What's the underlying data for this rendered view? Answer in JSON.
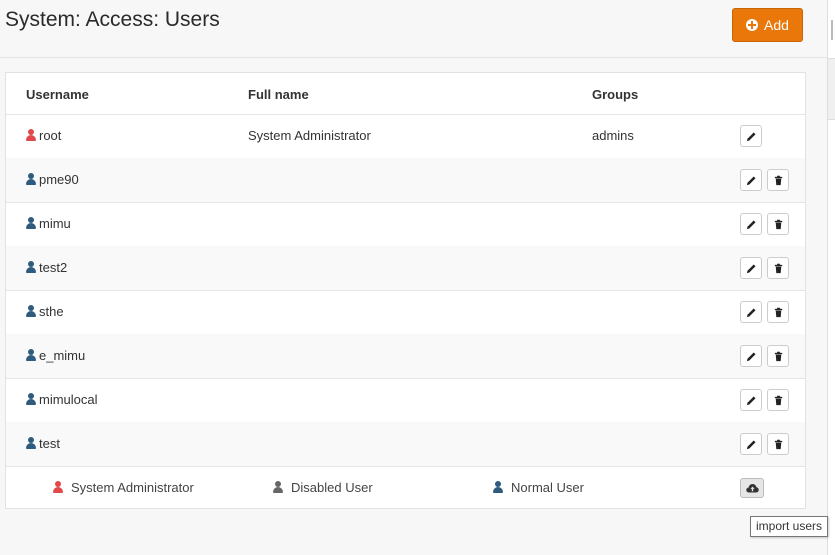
{
  "page": {
    "title": "System: Access: Users"
  },
  "toolbar": {
    "add_label": "Add"
  },
  "table": {
    "headers": [
      "Username",
      "Full name",
      "Groups"
    ],
    "rows": [
      {
        "username": "root",
        "full_name": "System Administrator",
        "groups": "admins",
        "type": "admin"
      },
      {
        "username": "pme90",
        "full_name": "",
        "groups": "",
        "type": "normal"
      },
      {
        "username": "mimu",
        "full_name": "",
        "groups": "",
        "type": "normal"
      },
      {
        "username": "test2",
        "full_name": "",
        "groups": "",
        "type": "normal"
      },
      {
        "username": "sthe",
        "full_name": "",
        "groups": "",
        "type": "normal"
      },
      {
        "username": "e_mimu",
        "full_name": "",
        "groups": "",
        "type": "normal"
      },
      {
        "username": "mimulocal",
        "full_name": "",
        "groups": "",
        "type": "normal"
      },
      {
        "username": "test",
        "full_name": "",
        "groups": "",
        "type": "normal"
      }
    ]
  },
  "legend": {
    "admin": "System Administrator",
    "disabled": "Disabled User",
    "normal": "Normal User"
  },
  "tooltip": {
    "import_users": "import users"
  },
  "colors": {
    "accent": "#e9770a",
    "admin_icon": "#e2484a",
    "normal_icon": "#2e5b7e",
    "disabled_icon": "#666666"
  },
  "icons": {
    "add": "plus-circle-icon",
    "user": "user-icon",
    "edit": "pencil-icon",
    "delete": "trash-icon",
    "import": "cloud-upload-icon"
  }
}
